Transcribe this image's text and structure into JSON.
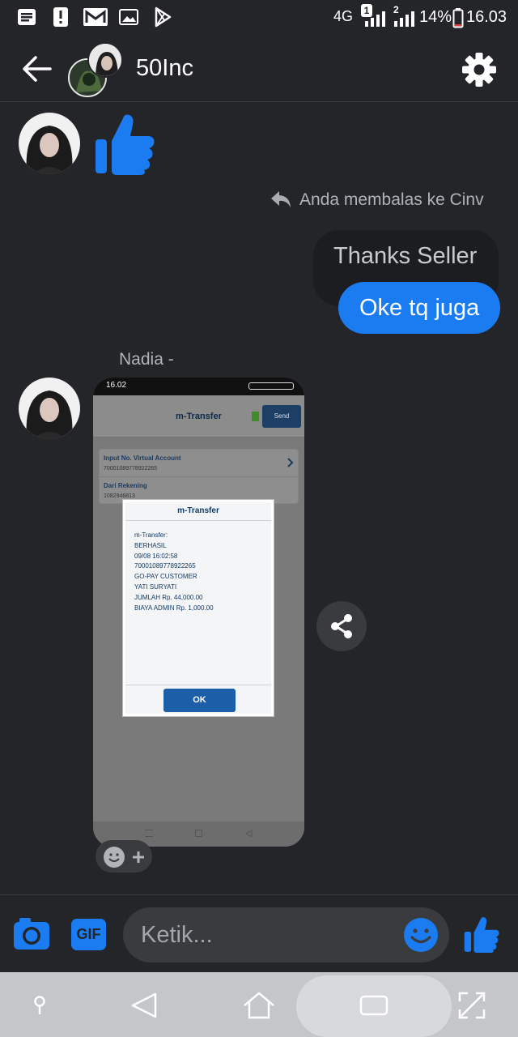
{
  "status_bar": {
    "network": "4G",
    "sim1": "1",
    "sim2": "2",
    "battery": "14%",
    "time": "16.03"
  },
  "header": {
    "title": "50Inc"
  },
  "chat": {
    "reply_notice": "Anda membalas ke Cinv",
    "outgoing": [
      "Thanks Seller",
      "Oke tq juga"
    ],
    "sender_name": "Nadia -",
    "screenshot": {
      "phone_time": "16.02",
      "page_title": "m-Transfer",
      "send_label": "Send",
      "va_label": "Input No. Virtual Account",
      "va_value": "70001089778922265",
      "from_label": "Dari Rekening",
      "from_value": "1082946813",
      "dialog_title": "m-Transfer",
      "dialog_lines": [
        "m-Transfer:",
        "BERHASIL",
        "09/08 16:02:58",
        "70001089778922265",
        "GO-PAY CUSTOMER",
        "YATI SURYATI",
        "JUMLAH Rp. 44,000.00",
        "BIAYA ADMIN Rp. 1,000.00"
      ],
      "ok_label": "OK"
    }
  },
  "composer": {
    "gif_label": "GIF",
    "placeholder": "Ketik..."
  },
  "colors": {
    "accent": "#1b7cf2",
    "background": "#242529",
    "incoming_bubble": "#1c1d20"
  }
}
